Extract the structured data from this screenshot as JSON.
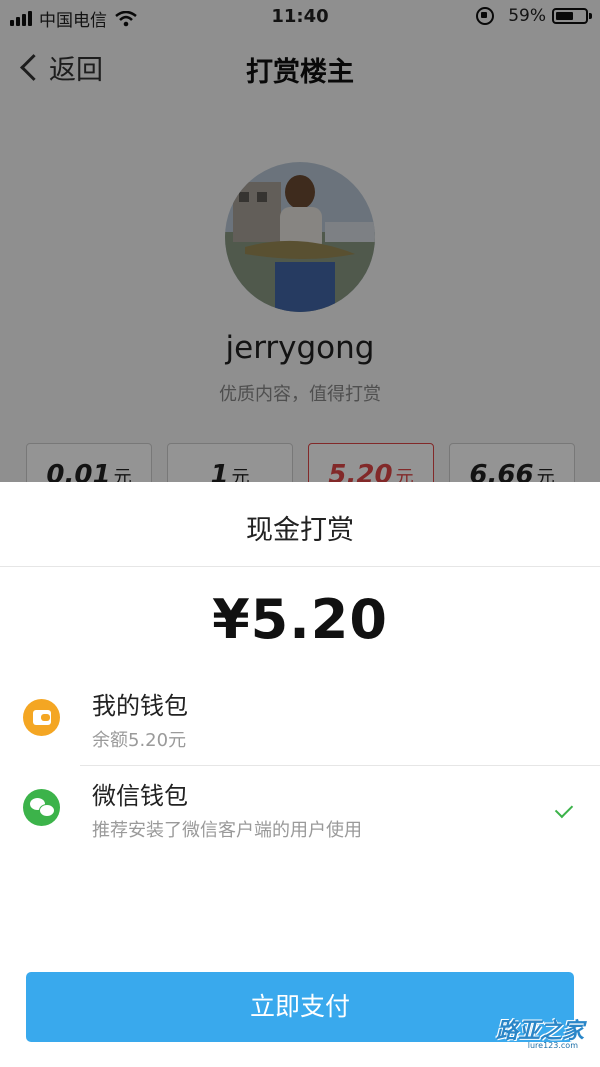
{
  "status_bar": {
    "carrier": "中国电信",
    "time": "11:40",
    "battery": "59%",
    "battery_level": 0.59
  },
  "nav": {
    "back_label": "返回",
    "title": "打赏楼主"
  },
  "profile": {
    "username": "jerrygong",
    "subtitle": "优质内容，值得打赏"
  },
  "amount_options": [
    {
      "value": "0.01",
      "unit": "元",
      "selected": false
    },
    {
      "value": "1",
      "unit": "元",
      "selected": false
    },
    {
      "value": "5.20",
      "unit": "元",
      "selected": true
    },
    {
      "value": "6.66",
      "unit": "元",
      "selected": false
    }
  ],
  "sheet": {
    "title": "现金打赏",
    "amount": "¥5.20",
    "methods": [
      {
        "name": "我的钱包",
        "desc": "余额5.20元",
        "icon": "wallet-icon",
        "selected": false
      },
      {
        "name": "微信钱包",
        "desc": "推荐安装了微信客户端的用户使用",
        "icon": "wechat-icon",
        "selected": true
      }
    ],
    "pay_button": "立即支付"
  },
  "colors": {
    "accent": "#39a9ed",
    "selected_amount": "#e04848",
    "wechat": "#3cb34a",
    "wallet": "#f4a623"
  }
}
